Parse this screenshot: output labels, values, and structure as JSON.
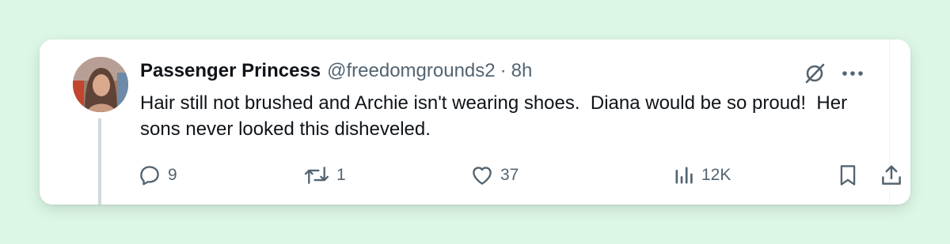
{
  "tweet": {
    "display_name": "Passenger Princess",
    "handle": "@freedomgrounds2",
    "separator": "·",
    "time": "8h",
    "text": "Hair still not brushed and Archie isn't wearing shoes.  Diana would be so proud!  Her sons never looked this disheveled."
  },
  "metrics": {
    "replies": "9",
    "reposts": "1",
    "likes": "37",
    "views": "12K"
  },
  "icons": {
    "reply": "reply-icon",
    "repost": "repost-icon",
    "like": "like-icon",
    "views": "views-icon",
    "bookmark": "bookmark-icon",
    "share": "share-icon",
    "grok": "grok-icon",
    "more": "more-icon"
  },
  "colors": {
    "background": "#dcf7e6",
    "card": "#ffffff",
    "primary_text": "#0f1419",
    "secondary_text": "#536471",
    "thread_line": "#cfd9de"
  }
}
